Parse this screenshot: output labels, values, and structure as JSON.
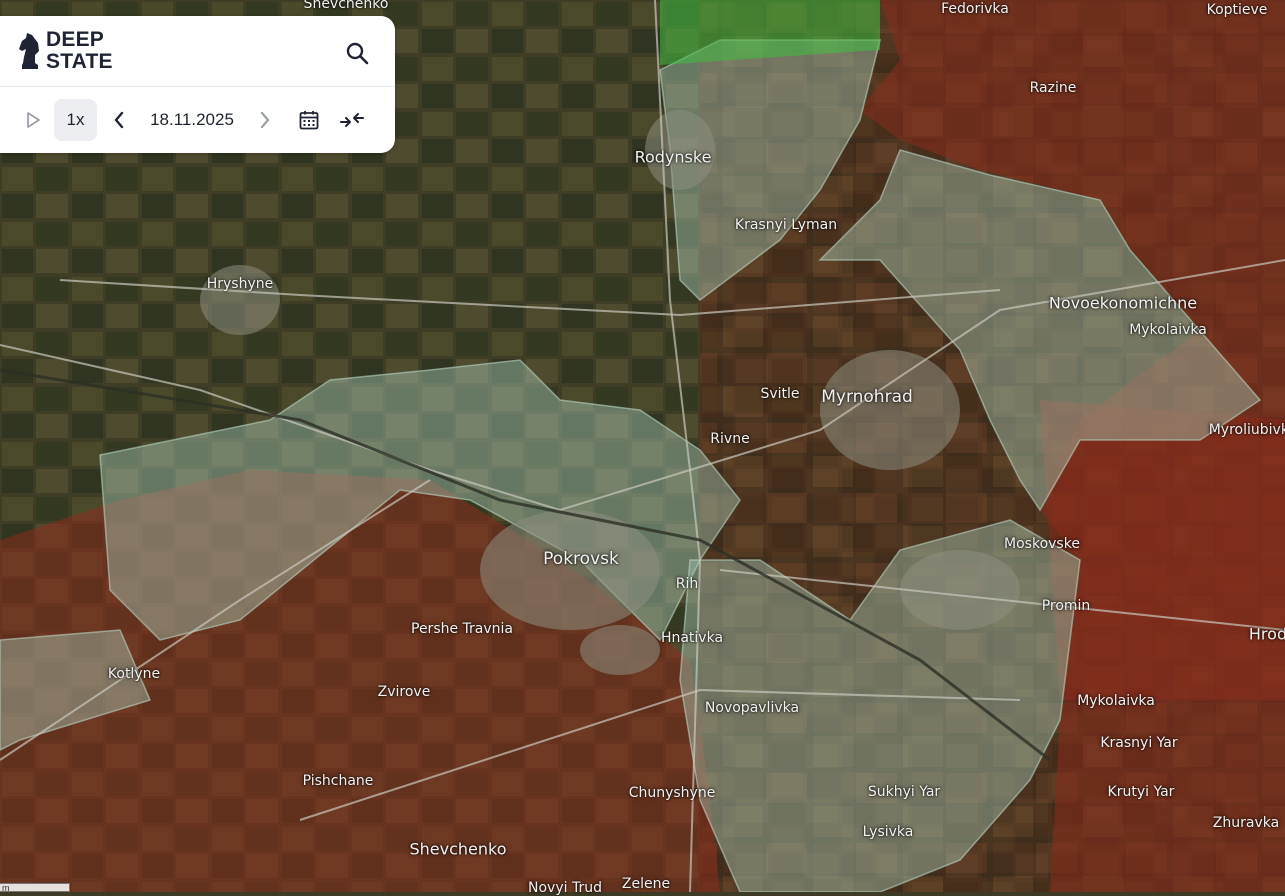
{
  "app": {
    "brand_line1": "DEEP",
    "brand_line2": "STATE",
    "brand_color": "#1e2433"
  },
  "controls": {
    "play_icon": "play-icon",
    "speed": "1x",
    "date": "18.11.2025",
    "prev_icon": "chevron-left-icon",
    "next_icon": "chevron-right-icon",
    "calendar_icon": "calendar-icon",
    "compare_icon": "compress-arrows-icon",
    "search_icon": "search-icon"
  },
  "map": {
    "occupied_color": "#8a2c1c",
    "contested_color": "#a6c8b4",
    "liberated_color": "#3fbf3f",
    "scale_label": "m",
    "places": [
      {
        "name": "Shevchenko"
      },
      {
        "name": "Fedorivka"
      },
      {
        "name": "Koptieve"
      },
      {
        "name": "Razine"
      },
      {
        "name": "Rodynske"
      },
      {
        "name": "Krasnyi Lyman"
      },
      {
        "name": "Hryshyne"
      },
      {
        "name": "Novoekonomichne"
      },
      {
        "name": "Mykolaivka"
      },
      {
        "name": "Svitle"
      },
      {
        "name": "Myrnohrad"
      },
      {
        "name": "Myroliubivka"
      },
      {
        "name": "Rivne"
      },
      {
        "name": "Moskovske"
      },
      {
        "name": "Pokrovsk"
      },
      {
        "name": "Rih"
      },
      {
        "name": "Promin"
      },
      {
        "name": "Hrod"
      },
      {
        "name": "Pershe Travnia"
      },
      {
        "name": "Hnativka"
      },
      {
        "name": "Kotlyne"
      },
      {
        "name": "Zvirove"
      },
      {
        "name": "Novopavlivka"
      },
      {
        "name": "Mykolaivka"
      },
      {
        "name": "Krasnyi Yar"
      },
      {
        "name": "Pishchane"
      },
      {
        "name": "Chunyshyne"
      },
      {
        "name": "Sukhyi Yar"
      },
      {
        "name": "Krutyi Yar"
      },
      {
        "name": "Lysivka"
      },
      {
        "name": "Zhuravka"
      },
      {
        "name": "Shevchenko"
      },
      {
        "name": "Novyi Trud"
      },
      {
        "name": "Zelene"
      }
    ]
  }
}
